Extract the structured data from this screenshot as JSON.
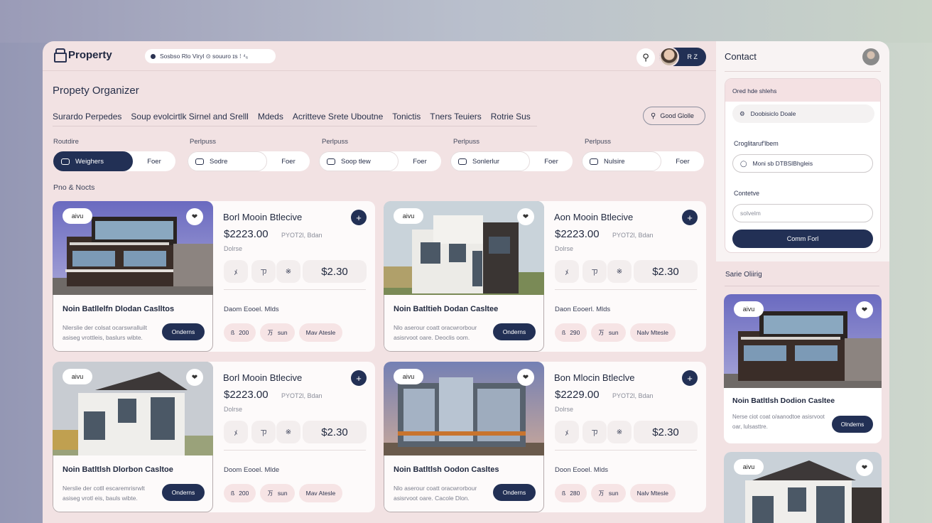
{
  "app": {
    "logo_text": "Property",
    "breadcrumb": "Sosbso Rlo Viryl  ⊙ souuro ɪs  ⁝  ⁴₆",
    "avatar_label": "R Z"
  },
  "main": {
    "page_title": "Propety Organizer",
    "filter_tabs": [
      "Surardo Perpedes",
      "Soup evolcirtlk Sirnel and Srelll",
      "Mdeds",
      "Acritteve Srete Uboutne",
      "Tonictis",
      "Tners Teuiers",
      "Rotrie Sus"
    ],
    "good_button": "Good Glolle",
    "segments": [
      {
        "label": "Routdire",
        "on": "Weighers",
        "off": "Foer",
        "dark": true
      },
      {
        "label": "Perlpuss",
        "on": "Sodre",
        "off": "Foer",
        "dark": false
      },
      {
        "label": "Perlpuss",
        "on": "Soop tlew",
        "off": "Foer",
        "dark": false
      },
      {
        "label": "Perlpuss",
        "on": "Sonlerlur",
        "off": "Foer",
        "dark": false
      },
      {
        "label": "Perlpuss",
        "on": "Nulsire",
        "off": "Foer",
        "dark": false
      }
    ],
    "section_note": "Pno & Nocts"
  },
  "cards": [
    {
      "badge": "aivu",
      "name": "Noin Batllelfn Dlodan Caslltos",
      "desc": "Nlerslie der colsat ocarswralluilt asiseg vrottleis, baslurs wibte.",
      "cta": "Onderns",
      "title": "Borl Mooin Btlecive",
      "price": "$2223.00",
      "sub": "PYOT2l, Bdan",
      "type": "Dolrse",
      "chips": [
        "ﾒ",
        "ㄗ",
        "※"
      ],
      "bigprice": "$2.30",
      "meta": "Daom Eooel. Mlds",
      "pills": [
        {
          "icon": "ß",
          "text": "200"
        },
        {
          "icon": "ㄪ",
          "text": "sun"
        },
        {
          "icon": "",
          "text": "Mav Atesle"
        }
      ]
    },
    {
      "badge": "aivu",
      "name": "Noin Batltieh Dodan Casltee",
      "desc": "Nlo aserour coatt oracwrorbour asisrvoot oare. Deoclis oom.",
      "cta": "Onderns",
      "title": "Aon Mooin Btlecive",
      "price": "$2223.00",
      "sub": "PYOT2l, Bdan",
      "type": "Dolrse",
      "chips": [
        "ﾒ",
        "ㄗ",
        "※"
      ],
      "bigprice": "$2.30",
      "meta": "Daon Eooerl. Mlds",
      "pills": [
        {
          "icon": "ß",
          "text": "290"
        },
        {
          "icon": "ㄪ",
          "text": "sun"
        },
        {
          "icon": "",
          "text": "Nalv Mtesle"
        }
      ]
    },
    {
      "badge": "aivu",
      "name": "Noin Batltlsh Dlorbon Casltoe",
      "desc": "Nerslie der cotll escaremrisrwlt asiseg vrotl eis, bauls wibte.",
      "cta": "Onderns",
      "title": "Borl Mooin Btlecive",
      "price": "$2223.00",
      "sub": "PYOT2l, Bdan",
      "type": "Dolrse",
      "chips": [
        "ﾒ",
        "ㄗ",
        "※"
      ],
      "bigprice": "$2.30",
      "meta": "Doom Eooel. Mlde",
      "pills": [
        {
          "icon": "ß",
          "text": "200"
        },
        {
          "icon": "ㄪ",
          "text": "sun"
        },
        {
          "icon": "",
          "text": "Mav Atesle"
        }
      ]
    },
    {
      "badge": "aivu",
      "name": "Noin Batltlsh Oodon Casltes",
      "desc": "Nlo aserour coatt oracwrorbour asisrvoot oare. Cacole Dlon.",
      "cta": "Onderns",
      "title": "Bon Mlocin Btleclve",
      "price": "$2229.00",
      "sub": "PYOT2l, Bdan",
      "type": "Dolrse",
      "chips": [
        "ﾒ",
        "ㄗ",
        "※"
      ],
      "bigprice": "$2.30",
      "meta": "Doon Eooel. Mlds",
      "pills": [
        {
          "icon": "ß",
          "text": "280"
        },
        {
          "icon": "ㄪ",
          "text": "sun"
        },
        {
          "icon": "",
          "text": "Nalv Mtesle"
        }
      ]
    }
  ],
  "contact": {
    "title": "Contact",
    "box_header": "Ored  hde shlehs",
    "field1": "Doobisiclo  Doale",
    "label2": "Croglitaruf'lbem",
    "input2": "Moni sb DTBSlBhgleis",
    "label3": "Contetve",
    "input3_placeholder": "solvelm",
    "submit": "Comm Forl"
  },
  "saved": {
    "title": "Sarie Oliirig",
    "cards": [
      {
        "badge": "aivu",
        "name": "Noin Batltlsh Dodion Casltee",
        "desc": "Nerse ciot coat o/aanodtoe asisrvoot oar, lulsasttre.",
        "cta": "Olnderns"
      },
      {
        "badge": "aivu",
        "name": "",
        "desc": "",
        "cta": ""
      }
    ]
  },
  "colors": {
    "accent": "#223055",
    "panel": "#f2e2e3",
    "card": "#fdfafa"
  }
}
